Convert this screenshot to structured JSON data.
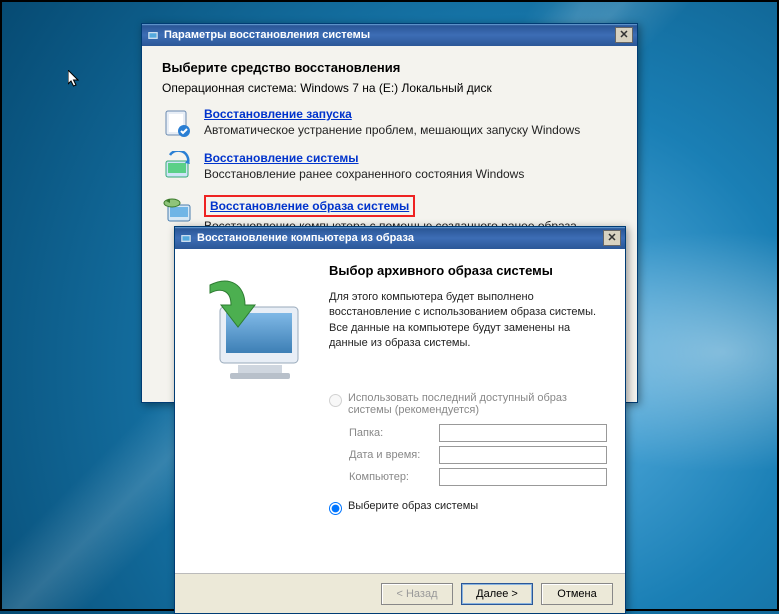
{
  "win1": {
    "title": "Параметры восстановления системы",
    "heading": "Выберите средство восстановления",
    "os_line": "Операционная система: Windows 7 на (E:) Локальный диск",
    "items": [
      {
        "link": "Восстановление запуска",
        "desc": "Автоматическое устранение проблем, мешающих запуску Windows"
      },
      {
        "link": "Восстановление системы",
        "desc": "Восстановление ранее сохраненного состояния Windows"
      },
      {
        "link": "Восстановление образа системы",
        "desc": "Восстановление компьютера с помощью созданного ранее образа системы"
      }
    ]
  },
  "win2": {
    "title": "Восстановление компьютера из образа",
    "heading": "Выбор архивного образа системы",
    "desc": "Для этого компьютера будет выполнено восстановление с использованием образа системы. Все данные на компьютере будут заменены на данные из образа системы.",
    "radio1": "Использовать последний доступный образ системы (рекомендуется)",
    "fields": {
      "folder_label": "Папка:",
      "datetime_label": "Дата и время:",
      "computer_label": "Компьютер:"
    },
    "radio2": "Выберите образ системы",
    "buttons": {
      "back": "< Назад",
      "next": "Далее >",
      "cancel": "Отмена"
    }
  }
}
